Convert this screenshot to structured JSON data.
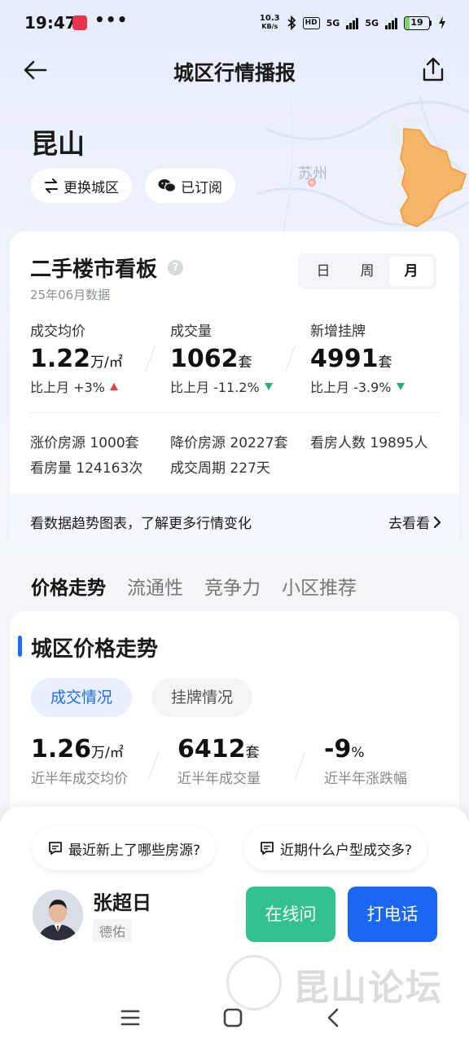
{
  "status_bar": {
    "time": "19:47",
    "dots": "•••",
    "net_speed_value": "10.3",
    "net_speed_unit": "KB/s",
    "hd_label": "HD",
    "network_1": "5G",
    "network_2": "5G",
    "battery_level": "19",
    "battery_percent": 19
  },
  "nav": {
    "title": "城区行情播报"
  },
  "city": {
    "name": "昆山",
    "switch_label": "更换城区",
    "subscribe_label": "已订阅",
    "map_city_label": "苏州"
  },
  "board": {
    "title": "二手楼市看板",
    "help_label": "?",
    "date": "25年06月数据",
    "periods": [
      "日",
      "周",
      "月"
    ],
    "active_period": "月",
    "stats": [
      {
        "label": "成交均价",
        "value": "1.22",
        "unit": "万/㎡",
        "change_label": "比上月 +3%",
        "direction": "up"
      },
      {
        "label": "成交量",
        "value": "1062",
        "unit": "套",
        "change_label": "比上月 -11.2%",
        "direction": "down"
      },
      {
        "label": "新增挂牌",
        "value": "4991",
        "unit": "套",
        "change_label": "比上月 -3.9%",
        "direction": "down"
      }
    ],
    "mini_stats": {
      "rising": "涨价房源 1000套",
      "falling": "降价房源 20227套",
      "viewers": "看房人数 19895人",
      "views": "看房量 124163次",
      "cycle": "成交周期 227天"
    },
    "footer_text": "看数据趋势图表，了解更多行情变化",
    "footer_link": "去看看"
  },
  "tabs": [
    "价格走势",
    "流通性",
    "竞争力",
    "小区推荐"
  ],
  "price_trend": {
    "title": "城区价格走势",
    "chips": [
      "成交情况",
      "挂牌情况"
    ],
    "stats": [
      {
        "value": "1.26",
        "unit": "万/㎡",
        "label": "近半年成交均价"
      },
      {
        "value": "6412",
        "unit": "套",
        "label": "近半年成交量"
      },
      {
        "value": "-9",
        "unit": "%",
        "label": "近半年涨跌幅"
      }
    ]
  },
  "sheet": {
    "question_1": "最近新上了哪些房源?",
    "question_2": "近期什么户型成交多?",
    "agent_name": "张超日",
    "agent_company": "德佑",
    "online_label": "在线问",
    "call_label": "打电话"
  },
  "watermark": {
    "text": "昆山论坛"
  },
  "colors": {
    "accent_blue": "#1f6bff",
    "green": "#34c191",
    "call_blue": "#1a66f5",
    "up_red": "#e54040",
    "down_green": "#23b26d",
    "map_highlight": "#f6b566"
  }
}
